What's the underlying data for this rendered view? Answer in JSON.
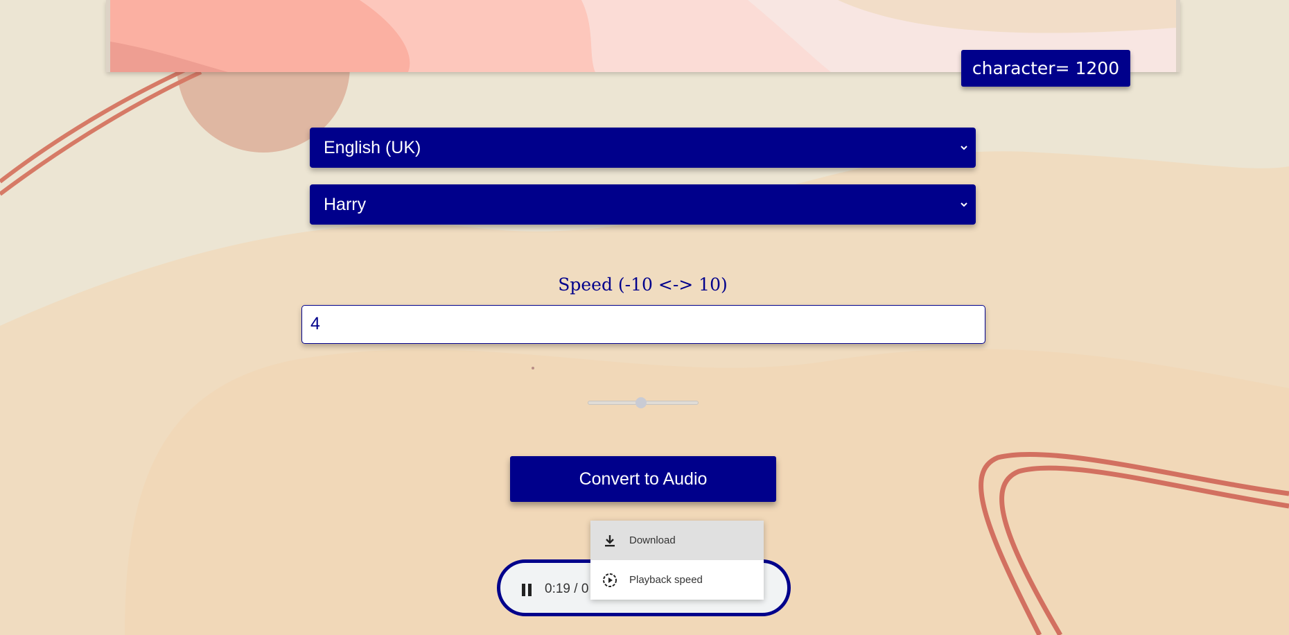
{
  "character_count_label": "character= 1200",
  "language_select": {
    "value": "English (UK)"
  },
  "voice_select": {
    "value": "Harry"
  },
  "speed": {
    "label": "Speed (-10 <-> 10)",
    "value": "4",
    "slider_fraction": 0.5
  },
  "convert_button": "Convert to Audio",
  "player": {
    "time": "0:19 / 0",
    "state": "playing"
  },
  "context_menu": {
    "items": [
      {
        "label": "Download",
        "icon": "download-icon"
      },
      {
        "label": "Playback speed",
        "icon": "playback-speed-icon"
      }
    ]
  },
  "colors": {
    "primary": "#00008b",
    "background": "#efe6d6",
    "accent_stroke": "#d2705a",
    "menu_highlight": "#e0e0e0"
  }
}
